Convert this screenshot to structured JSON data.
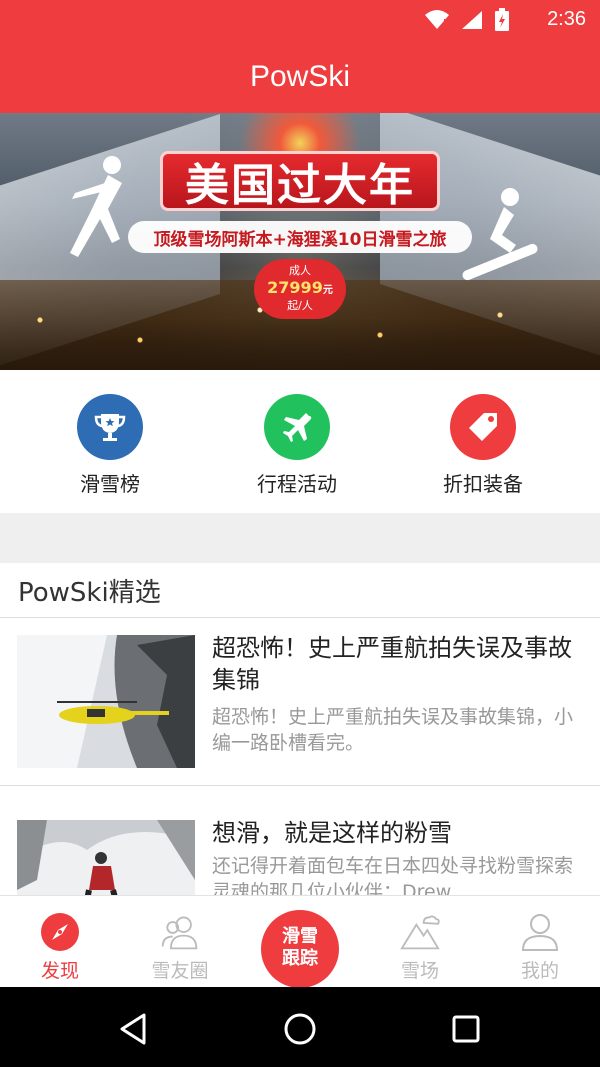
{
  "status": {
    "time": "2:36"
  },
  "app": {
    "title": "PowSki"
  },
  "banner": {
    "headline": "美国过大年",
    "subtitle": "顶级雪场阿斯本+海狸溪10日滑雪之旅",
    "badge_top": "成人",
    "price": "27999",
    "price_unit": "元",
    "badge_bottom": "起/人"
  },
  "quick_actions": [
    {
      "label": "滑雪榜",
      "icon": "trophy-icon",
      "color": "#2e6db4"
    },
    {
      "label": "行程活动",
      "icon": "airplane-icon",
      "color": "#21c25e"
    },
    {
      "label": "折扣装备",
      "icon": "tag-icon",
      "color": "#ee3c3f"
    }
  ],
  "section": {
    "title": "PowSki精选"
  },
  "articles": [
    {
      "title": "超恐怖！史上严重航拍失误及事故集锦",
      "desc": "超恐怖！史上严重航拍失误及事故集锦，小编一路卧槽看完。"
    },
    {
      "title": "想滑，就是这样的粉雪",
      "desc": "还记得开着面包车在日本四处寻找粉雪探索灵魂的那几位小伙伴：Drew,"
    }
  ],
  "tabs": {
    "discover": "发现",
    "friends": "雪友圈",
    "track_line1": "滑雪",
    "track_line2": "跟踪",
    "resorts": "雪场",
    "mine": "我的"
  },
  "colors": {
    "primary": "#ee3c3f",
    "inactive": "#bbbbbb"
  }
}
